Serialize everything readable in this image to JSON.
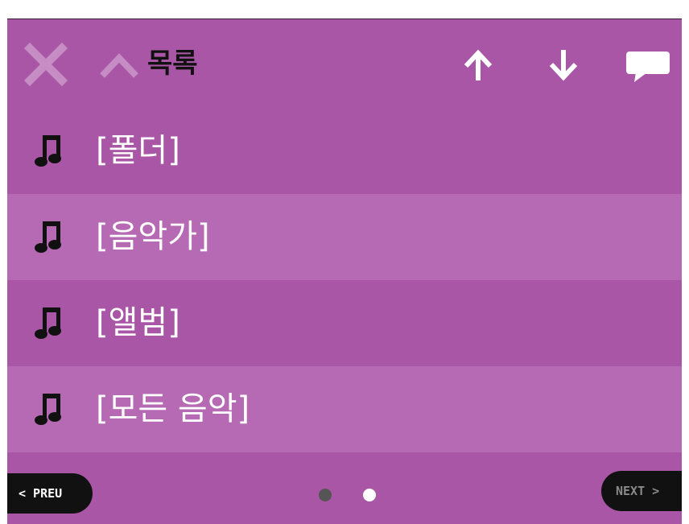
{
  "header": {
    "title": "목록",
    "close_icon": "close-icon",
    "up_icon": "chevron-up-icon",
    "scroll_up_icon": "arrow-up-icon",
    "scroll_down_icon": "arrow-down-icon",
    "chat_icon": "speech-bubble-icon"
  },
  "list": {
    "items": [
      {
        "label": "[폴더]",
        "icon": "music-note-icon"
      },
      {
        "label": "[음악가]",
        "icon": "music-note-icon"
      },
      {
        "label": "[앨범]",
        "icon": "music-note-icon"
      },
      {
        "label": "[모든 음악]",
        "icon": "music-note-icon"
      }
    ]
  },
  "footer": {
    "prev_label": "< PREU",
    "next_label": "NEXT >",
    "page_count": 2,
    "active_page": 2
  },
  "colors": {
    "background": "#a856a5",
    "alt_row": "#b76ab4",
    "button_bg": "#111111",
    "disabled_icon": "#c58dc3"
  }
}
